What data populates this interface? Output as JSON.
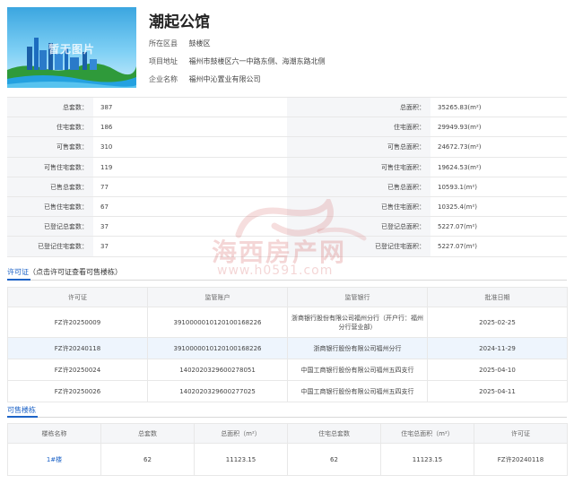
{
  "project": {
    "title": "潮起公馆",
    "info": [
      {
        "label": "所在区县",
        "value": "鼓楼区"
      },
      {
        "label": "项目地址",
        "value": "福州市鼓楼区六一中路东侧、海潮东路北侧"
      },
      {
        "label": "企业名称",
        "value": "福州中沁置业有限公司"
      }
    ]
  },
  "thumbnail": {
    "overlay_text": "暂无图片"
  },
  "stats": [
    {
      "l1": "总套数：",
      "v1": "387",
      "l2": "总面积：",
      "v2": "35265.83(m²)"
    },
    {
      "l1": "住宅套数：",
      "v1": "186",
      "l2": "住宅面积：",
      "v2": "29949.93(m²)"
    },
    {
      "l1": "可售套数：",
      "v1": "310",
      "l2": "可售总面积：",
      "v2": "24672.73(m²)"
    },
    {
      "l1": "可售住宅套数：",
      "v1": "119",
      "l2": "可售住宅面积：",
      "v2": "19624.53(m²)"
    },
    {
      "l1": "已售总套数：",
      "v1": "77",
      "l2": "已售总面积：",
      "v2": "10593.1(m²)"
    },
    {
      "l1": "已售住宅套数：",
      "v1": "67",
      "l2": "已售住宅面积：",
      "v2": "10325.4(m²)"
    },
    {
      "l1": "已登记总套数：",
      "v1": "37",
      "l2": "已登记总面积：",
      "v2": "5227.07(m²)"
    },
    {
      "l1": "已登记住宅套数：",
      "v1": "37",
      "l2": "已登记住宅面积：",
      "v2": "5227.07(m²)"
    }
  ],
  "watermark": {
    "brand": "海西房产网",
    "url": "www.h0591.com"
  },
  "permits": {
    "section_title": "许可证",
    "section_hint": "（点击许可证查看可售楼栋）",
    "headers": [
      "许可证",
      "监管账户",
      "监管银行",
      "批准日期"
    ],
    "rows": [
      {
        "permit": "FZ许20250009",
        "account": "391000001012010016822​6",
        "bank": "浙商银行股份有限公司福州分行（开户行：福州分行营业部）",
        "date": "2025-02-25"
      },
      {
        "permit": "FZ许20240118",
        "account": "3910000010120100168226",
        "bank": "浙商银行股份有限公司福州分行",
        "date": "2024-11-29"
      },
      {
        "permit": "FZ许20250024",
        "account": "1402020329600278051",
        "bank": "中国工商银行股份有限公司福州五四支行",
        "date": "2025-04-10"
      },
      {
        "permit": "FZ许20250026",
        "account": "1402020329600277025",
        "bank": "中国工商银行股份有限公司福州五四支行",
        "date": "2025-04-11"
      }
    ]
  },
  "buildings": {
    "section_title": "可售楼栋",
    "headers": [
      "楼栋名称",
      "总套数",
      "总面积（m²）",
      "住宅总套数",
      "住宅总面积（m²）",
      "许可证"
    ],
    "rows": [
      {
        "name": "1#楼",
        "total": "62",
        "area": "11123.15",
        "res_total": "62",
        "res_area": "11123.15",
        "permit": "FZ许20240118"
      }
    ]
  },
  "colors": {
    "accent": "#1d63c7",
    "label_bg": "#f5f6f8",
    "highlight_row": "#eef5fd"
  }
}
